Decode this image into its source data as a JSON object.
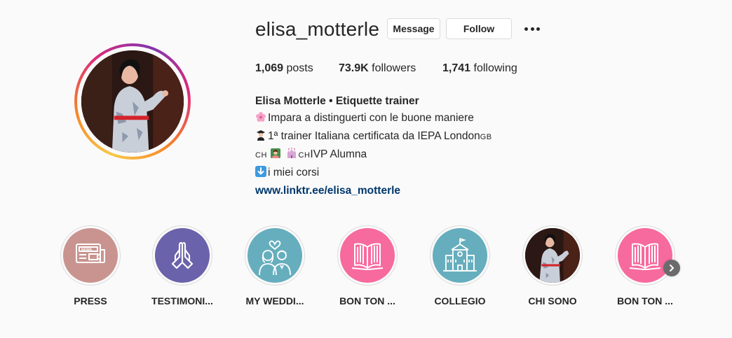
{
  "profile": {
    "username": "elisa_motterle",
    "message_label": "Message",
    "follow_label": "Follow",
    "more_icon": "more-options-icon"
  },
  "stats": {
    "posts_count": "1,069",
    "posts_label": "posts",
    "followers_count": "73.9K",
    "followers_label": "followers",
    "following_count": "1,741",
    "following_label": "following"
  },
  "bio": {
    "name": "Elisa Motterle • Etiquette trainer",
    "line1": "Impara a distinguerti con le buone maniere",
    "line2a": "1ª trainer Italiana certificata da IEPA London",
    "line2b": "GB",
    "line3a": "CH",
    "line3b": "CH",
    "line3c": "IVP Alumna",
    "line4": "i miei corsi",
    "link": "www.linktr.ee/elisa_motterle"
  },
  "highlights": [
    {
      "label": "PRESS",
      "icon": "news-icon",
      "color": "#c9948f"
    },
    {
      "label": "TESTIMONI...",
      "icon": "praying-hands-icon",
      "color": "#6a62aa"
    },
    {
      "label": "MY WEDDI...",
      "icon": "wedding-couple-icon",
      "color": "#66aebd"
    },
    {
      "label": "BON TON ...",
      "icon": "open-book-icon",
      "color": "#f76a9d"
    },
    {
      "label": "COLLEGIO",
      "icon": "college-building-icon",
      "color": "#66aebd"
    },
    {
      "label": "CHI SONO",
      "icon": "profile-photo",
      "color": "#2a1a15"
    },
    {
      "label": "BON TON ...",
      "icon": "open-book-icon",
      "color": "#f76a9d"
    }
  ],
  "colors": {
    "accent_link": "#00376b",
    "text": "#262626",
    "background": "#fafafa"
  }
}
